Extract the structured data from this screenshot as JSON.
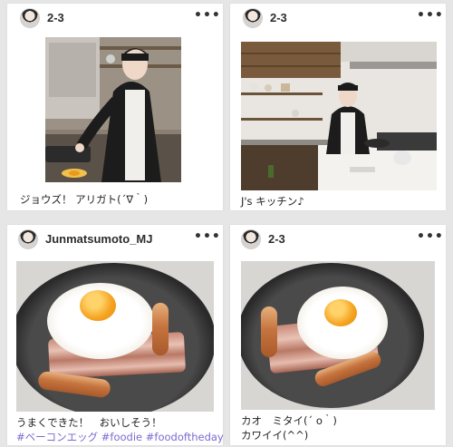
{
  "posts": [
    {
      "username": "2-3",
      "more_icon": "more-dots-icon",
      "caption": "ジョウズ！ アリガト(´∇｀)",
      "image": "cooking-at-stove-photo"
    },
    {
      "username": "2-3",
      "more_icon": "more-dots-icon",
      "caption": "J's キッチン♪",
      "image": "kitchen-photo"
    },
    {
      "username": "Junmatsumoto_MJ",
      "more_icon": "more-dots-icon",
      "caption_line1": "うまくできた！　おいしそう！",
      "hashtags": "#ベーコンエッグ #foodie #foodoftheday",
      "image": "bacon-egg-pan-photo"
    },
    {
      "username": "2-3",
      "more_icon": "more-dots-icon",
      "caption_line1": "カオ　ミタイ(´ o｀)",
      "caption_line2": "カワイイ(^^)",
      "image": "bacon-egg-face-photo"
    }
  ],
  "more_glyph": "•••"
}
